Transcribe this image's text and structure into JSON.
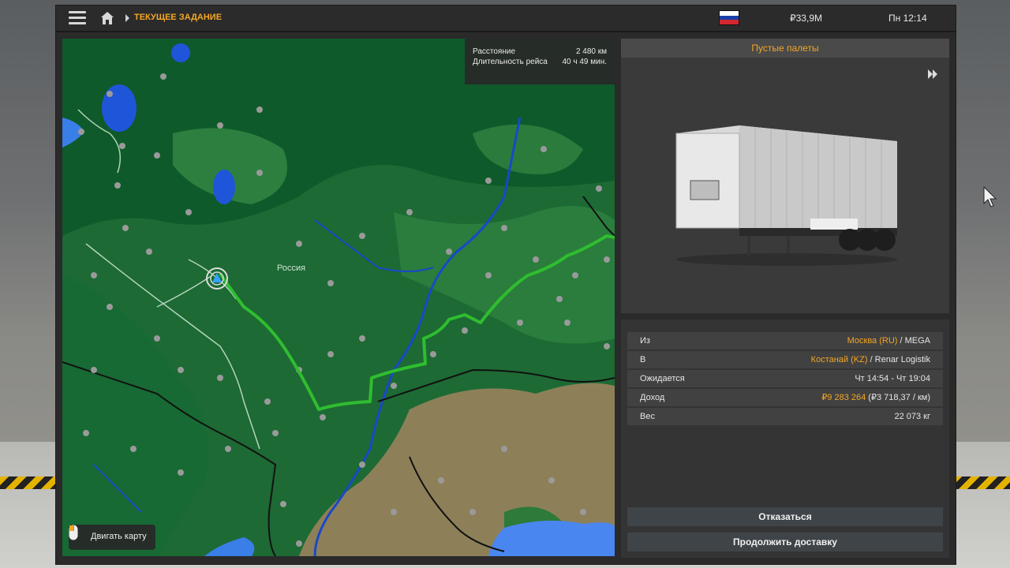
{
  "topbar": {
    "breadcrumb": "ТЕКУЩЕЕ ЗАДАНИЕ",
    "money": "₽33,9M",
    "time": "Пн 12:14",
    "flag_colors": [
      "#ffffff",
      "#1c3fa8",
      "#d22630"
    ]
  },
  "map": {
    "country_label": "Россия",
    "route_info": {
      "distance_label": "Расстояние",
      "distance_value": "2 480 км",
      "duration_label": "Длительность рейса",
      "duration_value": "40 ч 49 мин."
    },
    "move_map_label": "Двигать карту"
  },
  "cargo": {
    "title": "Пустые палеты"
  },
  "job": {
    "from_label": "Из",
    "from_city": "Москва (RU)",
    "from_company": " / MEGA",
    "to_label": "В",
    "to_city": "Костанай (KZ)",
    "to_company": " / Renar Logistik",
    "expected_label": "Ожидается",
    "expected_value": "Чт 14:54 - Чт 19:04",
    "income_label": "Доход",
    "income_value": "₽9 283 264",
    "income_rate": " (₽3 718,37 / км)",
    "weight_label": "Вес",
    "weight_value": "22 073 кг"
  },
  "buttons": {
    "decline": "Отказаться",
    "continue": "Продолжить доставку"
  },
  "colors": {
    "accent": "#f5a623",
    "route": "#2fbd2f",
    "water": "#1f55d8"
  }
}
